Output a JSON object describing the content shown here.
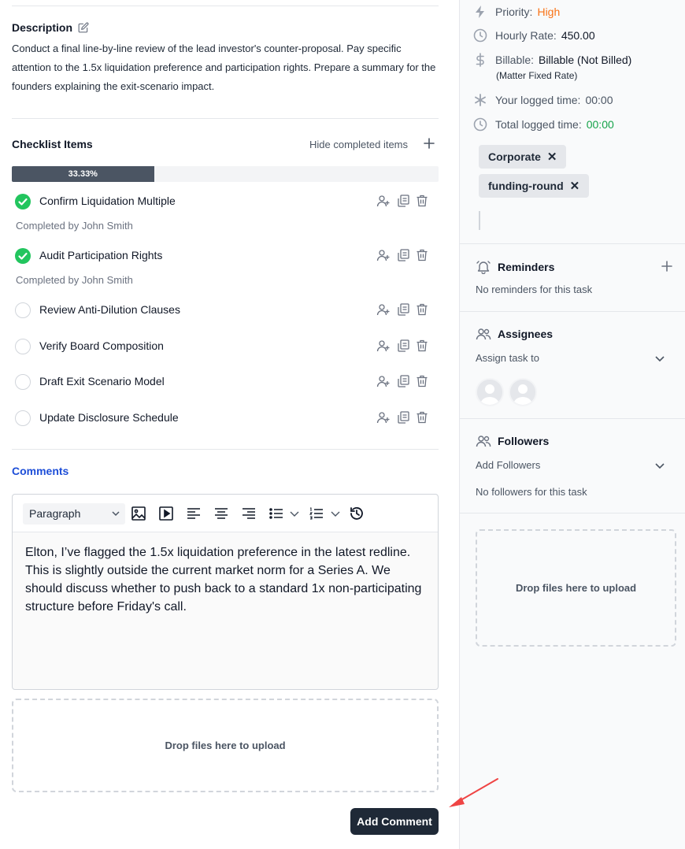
{
  "description": {
    "title": "Description",
    "text": "Conduct a final line-by-line review of the lead investor's counter-proposal. Pay specific attention to the 1.5x liquidation preference and participation rights. Prepare a summary for the founders explaining the exit-scenario impact."
  },
  "checklist": {
    "title": "Checklist Items",
    "hide_label": "Hide completed items",
    "progress_label": "33.33%",
    "progress_fraction": 0.3333,
    "items": [
      {
        "label": "Confirm Liquidation Multiple",
        "done": true,
        "completed_by": "Completed by John Smith"
      },
      {
        "label": "Audit Participation Rights",
        "done": true,
        "completed_by": "Completed by John Smith"
      },
      {
        "label": "Review Anti-Dilution Clauses",
        "done": false
      },
      {
        "label": "Verify Board Composition",
        "done": false
      },
      {
        "label": "Draft Exit Scenario Model",
        "done": false
      },
      {
        "label": "Update Disclosure Schedule",
        "done": false
      }
    ]
  },
  "comments": {
    "title": "Comments",
    "format_select": "Paragraph",
    "body": "Elton, I’ve flagged the 1.5x liquidation preference in the latest redline. This is slightly outside the current market norm for a Series A. We should discuss whether to push back to a standard 1x non-participating structure before Friday's call.",
    "dropzone": "Drop files here to upload",
    "submit_label": "Add Comment"
  },
  "meta": {
    "priority_label": "Priority:",
    "priority_value": "High",
    "rate_label": "Hourly Rate:",
    "rate_value": "450.00",
    "billable_label": "Billable:",
    "billable_value": "Billable (Not Billed)",
    "billable_note": "(Matter Fixed Rate)",
    "your_time_label": "Your logged time:",
    "your_time_value": "00:00",
    "total_time_label": "Total logged time:",
    "total_time_value": "00:00",
    "tags": [
      "Corporate",
      "funding-round"
    ]
  },
  "reminders": {
    "title": "Reminders",
    "empty": "No reminders for this task"
  },
  "assignees": {
    "title": "Assignees",
    "placeholder": "Assign task to"
  },
  "followers": {
    "title": "Followers",
    "placeholder": "Add Followers",
    "empty": "No followers for this task"
  },
  "sidebar_dropzone": "Drop files here to upload",
  "colors": {
    "accent_blue": "#1d4ed8",
    "success": "#22c55e",
    "priority_high": "#f97316",
    "primary_button": "#1f2937",
    "annotation_arrow": "#ef4444"
  }
}
